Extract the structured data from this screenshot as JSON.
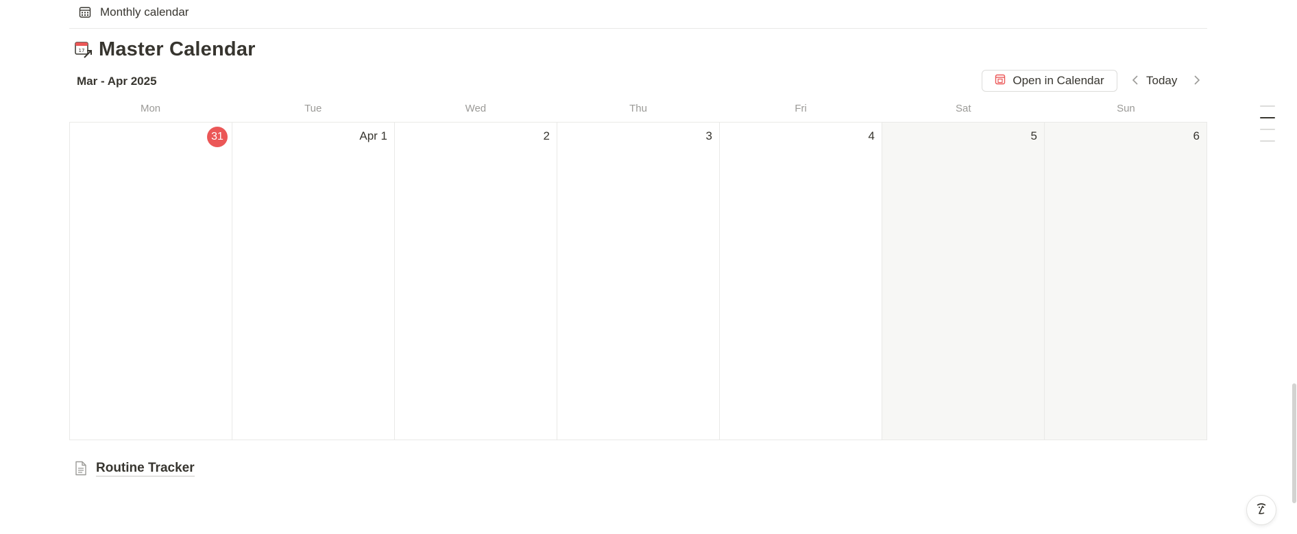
{
  "top_view": {
    "label": "Monthly calendar",
    "icon": "calendar-grid-icon"
  },
  "title": {
    "text": "Master Calendar",
    "icon": "calendar-link-icon"
  },
  "toolbar": {
    "month_label": "Mar - Apr 2025",
    "open_in_calendar": "Open in Calendar",
    "open_icon": "calendar-app-icon",
    "today": "Today",
    "prev_icon": "chevron-left-icon",
    "next_icon": "chevron-right-icon"
  },
  "weekdays": [
    "Mon",
    "Tue",
    "Wed",
    "Thu",
    "Fri",
    "Sat",
    "Sun"
  ],
  "days": [
    {
      "label": "31",
      "today": true,
      "weekend": false
    },
    {
      "label": "Apr 1",
      "today": false,
      "weekend": false
    },
    {
      "label": "2",
      "today": false,
      "weekend": false
    },
    {
      "label": "3",
      "today": false,
      "weekend": false
    },
    {
      "label": "4",
      "today": false,
      "weekend": false
    },
    {
      "label": "5",
      "today": false,
      "weekend": true
    },
    {
      "label": "6",
      "today": false,
      "weekend": true
    }
  ],
  "page_link": {
    "label": "Routine Tracker",
    "icon": "page-icon"
  },
  "colors": {
    "today_accent": "#eb5757",
    "text": "#37352f",
    "muted": "#9b9a97",
    "weekend_bg": "#f7f7f5",
    "border": "#e9e9e7"
  }
}
